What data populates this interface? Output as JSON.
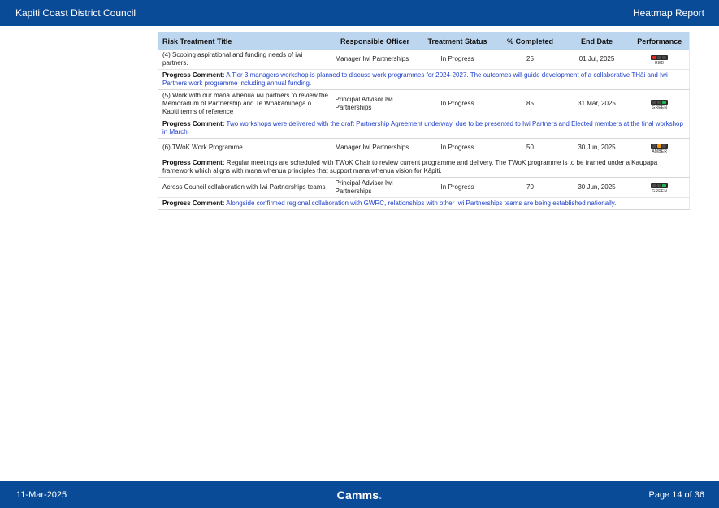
{
  "header": {
    "org": "Kapiti Coast District Council",
    "report": "Heatmap Report"
  },
  "footer": {
    "date": "11-Mar-2025",
    "logo": "Camms",
    "logo_dot": ".",
    "page": "Page 14 of 36"
  },
  "table": {
    "columns": [
      "Risk Treatment Title",
      "Responsible Officer",
      "Treatment Status",
      "% Completed",
      "End Date",
      "Performance"
    ],
    "comment_label": "Progress Comment:",
    "rows": [
      {
        "title": "(4) Scoping aspirational and funding needs of iwi partners.",
        "officer": "Manager Iwi Partnerships",
        "status": "In Progress",
        "completed": "25",
        "end_date": "01 Jul, 2025",
        "performance": "RED",
        "comment": "A Tier 3 managers workshop is planned to discuss work programmes for 2024-2027. The outcomes will guide development of a collaborative THāi and Iwi Partners work programme including annual funding."
      },
      {
        "title": "(5) Work with our mana whenua iwi partners to review the Memoradum of Partnership and Te Whakaminega o Kapiti terms of reference",
        "officer": "Principal Advisor Iwi Partnerships",
        "status": "In Progress",
        "completed": "85",
        "end_date": "31 Mar, 2025",
        "performance": "GREEN",
        "comment": "Two workshops were delivered with the draft Partnership Agreement underway, due to be presented to Iwi Partners and Elected members at the final workshop in March."
      },
      {
        "title": "(6) TWoK Work Programme",
        "officer": "Manager Iwi Partnerships",
        "status": "In Progress",
        "completed": "50",
        "end_date": "30 Jun, 2025",
        "performance": "AMBER",
        "comment": "Regular meetings are scheduled with TWoK Chair to review current programme and delivery. The TWoK programme is to be framed under a Kaupapa framework which aligns with mana whenua principles that support mana whenua vision for Kāpiti."
      },
      {
        "title": "Across Council collaboration with Iwi Partnerships teams",
        "officer": "Principal Advisor Iwi Partnerships",
        "status": "In Progress",
        "completed": "70",
        "end_date": "30 Jun, 2025",
        "performance": "GREEN",
        "comment": "Alongside confirmed regional collaboration with GWRC, relationships with other Iwi Partnerships teams are being established nationally."
      }
    ]
  },
  "colors": {
    "bar": "#0a4b97",
    "table_header": "#bcd6ef",
    "comment_blue": "#1f3fc9",
    "red": "#e0271f",
    "amber": "#f39a1d",
    "green": "#1fb64b"
  }
}
